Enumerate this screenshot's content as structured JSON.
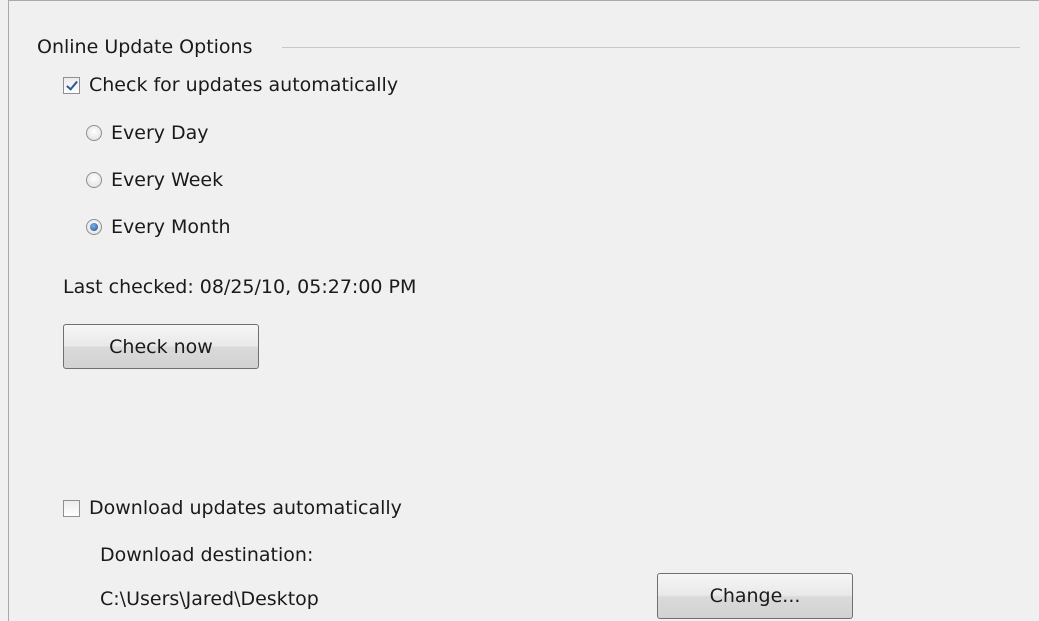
{
  "online_update": {
    "group_title": "Online Update Options",
    "check_auto": {
      "label": "Check for updates automatically",
      "checked": true
    },
    "frequency": [
      {
        "label": "Every Day",
        "selected": false
      },
      {
        "label": "Every Week",
        "selected": false
      },
      {
        "label": "Every Month",
        "selected": true
      }
    ],
    "last_checked": "Last checked: 08/25/10, 05:27:00 PM",
    "check_now_label": "Check now"
  },
  "download": {
    "auto": {
      "label": "Download updates automatically",
      "checked": false
    },
    "destination_label": "Download destination:",
    "destination_path": "C:\\Users\\Jared\\Desktop",
    "change_label": "Change..."
  }
}
